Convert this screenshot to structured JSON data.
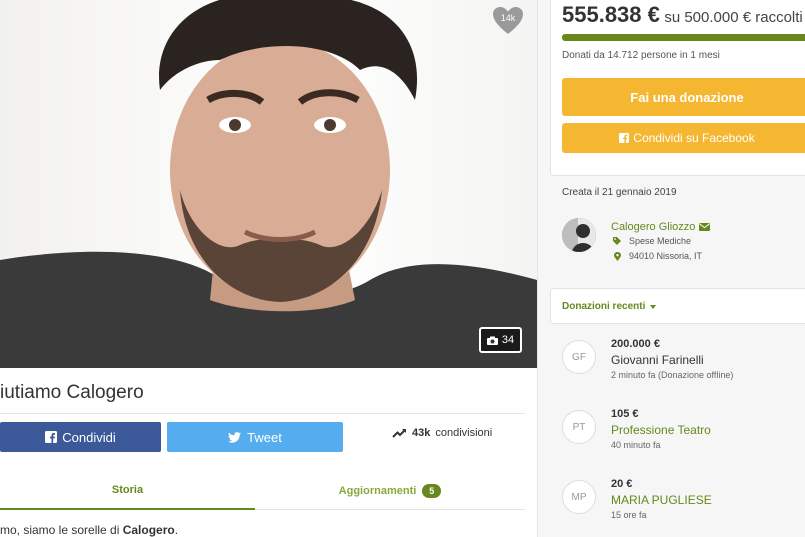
{
  "campaign": {
    "heart_count": "14k",
    "photo_count": "34",
    "title": "iutiamo Calogero",
    "story_prefix": "mo, siamo le sorelle di ",
    "story_name": "Calogero",
    "story_suffix": "."
  },
  "share": {
    "facebook_label": "Condividi",
    "twitter_label": "Tweet",
    "count": "43k",
    "count_label": "condivisioni"
  },
  "tabs": [
    {
      "label": "Storia"
    },
    {
      "label": "Aggiornamenti",
      "badge": "5"
    }
  ],
  "funding": {
    "raised": "555.838 €",
    "goal_text": "su 500.000 € raccolti",
    "progress_fraction": 1.0,
    "donors_text": "Donati da 14.712 persone in 1 mesi",
    "donate_label": "Fai una donazione",
    "share_fb_label": "Condividi su Facebook"
  },
  "details": {
    "created": "Creata il 21 gennaio 2019",
    "organizer_name": "Calogero Gliozzo",
    "category": "Spese Mediche",
    "location": "94010 Nissoria, IT"
  },
  "recent": {
    "title": "Donazioni recenti",
    "items": [
      {
        "initials": "GF",
        "amount": "200.000 €",
        "name": "Giovanni Farinelli",
        "time": "2 minuto fa (Donazione offline)"
      },
      {
        "initials": "PT",
        "amount": "105 €",
        "name": "Professione Teatro",
        "time": "40 minuto fa"
      },
      {
        "initials": "MP",
        "amount": "20 €",
        "name": "MARIA PUGLIESE",
        "time": "15 ore fa"
      }
    ]
  },
  "colors": {
    "accent_green": "#66881d",
    "donate_yellow": "#f5b731",
    "facebook_blue": "#3b5998",
    "twitter_blue": "#55acee"
  }
}
